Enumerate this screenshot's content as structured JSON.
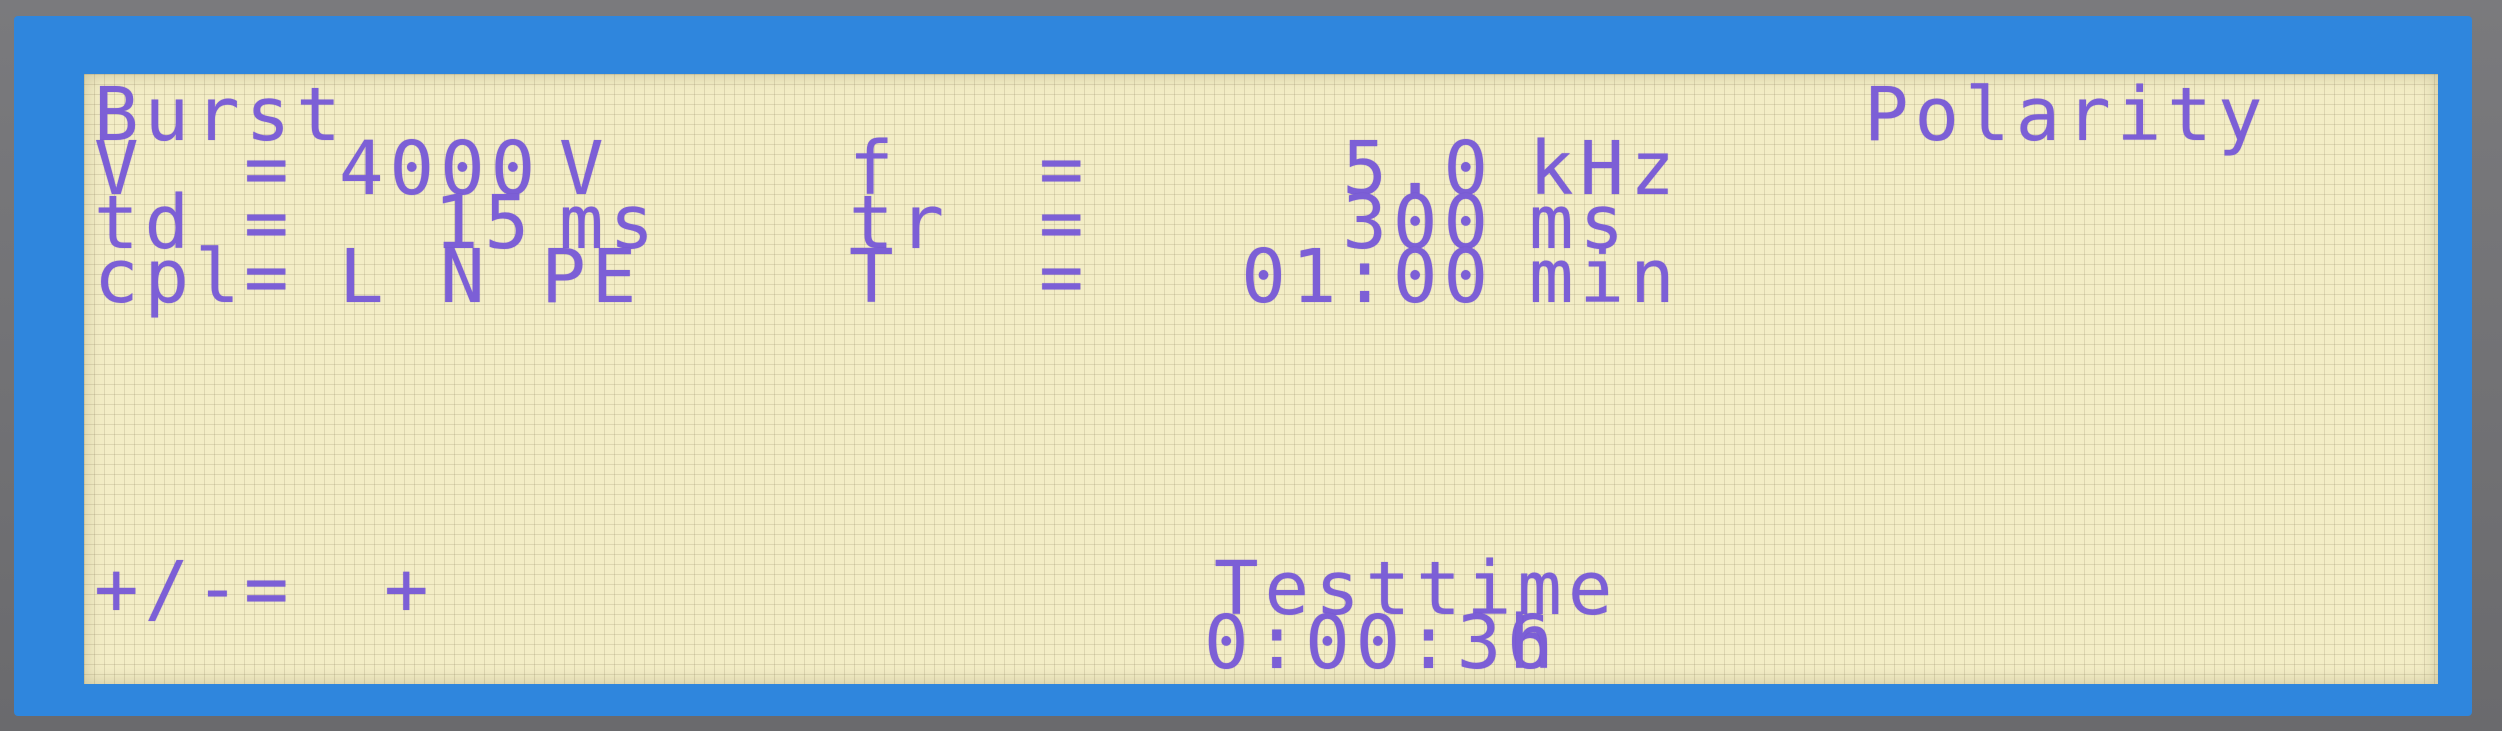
{
  "display": {
    "mode_title": "Burst",
    "top_right_label": "Polarity",
    "left_params": [
      {
        "name": "V",
        "eq": "=",
        "value": "4000",
        "unit": "V"
      },
      {
        "name": "td",
        "eq": "=",
        "value": "15",
        "unit": "ms"
      },
      {
        "name": "cpl",
        "eq": "=",
        "value": "L N PE",
        "unit": ""
      }
    ],
    "right_params": [
      {
        "name": "f",
        "eq": "=",
        "value": "5.0",
        "unit": "kHz"
      },
      {
        "name": "tr",
        "eq": "=",
        "value": "300",
        "unit": "ms"
      },
      {
        "name": "T",
        "eq": "=",
        "value": "01:00",
        "unit": "min"
      }
    ],
    "polarity_row": {
      "name": "+/-",
      "eq": "=",
      "value": "+"
    },
    "testtime": {
      "label": "Testtime",
      "value": "0:00:36",
      "unit": "h"
    }
  },
  "colors": {
    "lcd_background": "#f3edc6",
    "lcd_text": "#7c5fd6",
    "frame": "#2f86dd"
  }
}
